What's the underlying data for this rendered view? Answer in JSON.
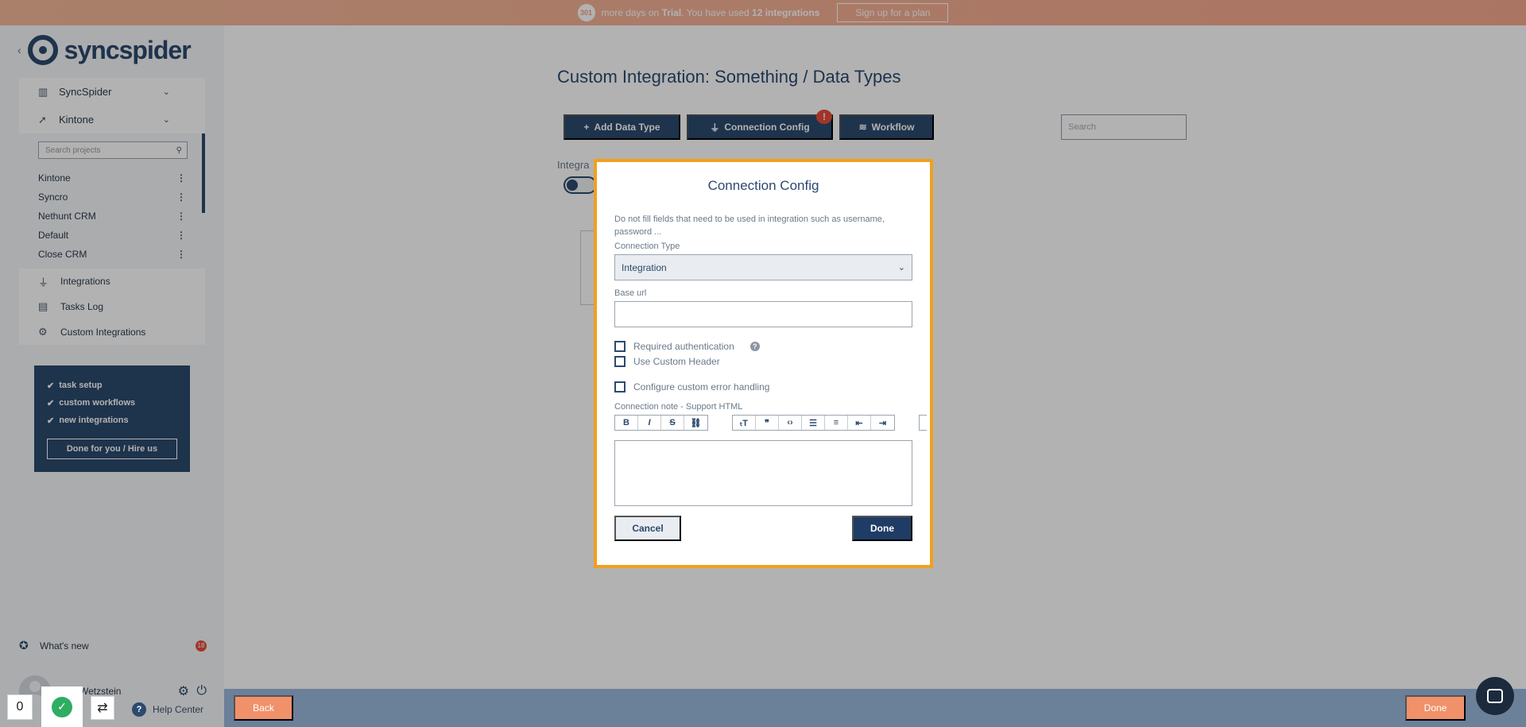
{
  "trial": {
    "days": "301",
    "text_pre": "more days on",
    "plan": "Trial",
    "text_mid": ". You have used",
    "count": "12 integrations",
    "signup_label": "Sign up for a plan"
  },
  "sidebar": {
    "brand": "syncspider",
    "orgs": [
      {
        "label": "SyncSpider",
        "icon": "building-icon"
      },
      {
        "label": "Kintone",
        "icon": "rocket-icon"
      }
    ],
    "project_search_placeholder": "Search projects",
    "projects": [
      "Kintone",
      "Syncro",
      "Nethunt CRM",
      "Default",
      "Close CRM"
    ],
    "nav": [
      {
        "label": "Integrations",
        "icon": "plug-icon"
      },
      {
        "label": "Tasks Log",
        "icon": "clipboard-icon"
      },
      {
        "label": "Custom Integrations",
        "icon": "gear-icon"
      }
    ],
    "promo": {
      "items": [
        "task setup",
        "custom workflows",
        "new integrations"
      ],
      "button": "Done for you / Hire us"
    },
    "whats_new": "What's new",
    "whats_new_count": "18",
    "user_name": "Igor Wetzstein",
    "help": "Help Center"
  },
  "main": {
    "title": "Custom Integration: Something / Data Types",
    "buttons": {
      "add": "Add Data Type",
      "connection": "Connection Config",
      "workflow": "Workflow"
    },
    "alert": "!",
    "search_placeholder": "Search",
    "integration_label": "Integra"
  },
  "modal": {
    "title": "Connection Config",
    "description": "Do not fill fields that need to be used in integration such as username, password ...",
    "connection_type_label": "Connection Type",
    "connection_type_value": "Integration",
    "base_url_label": "Base url",
    "base_url_value": "",
    "checkboxes": {
      "required_auth": "Required authentication",
      "custom_header": "Use Custom Header",
      "error_handling": "Configure custom error handling"
    },
    "note_label": "Connection note - Support HTML",
    "cancel": "Cancel",
    "done": "Done"
  },
  "bottom": {
    "back": "Back",
    "done": "Done"
  },
  "widgets": {
    "count": "0"
  },
  "colors": {
    "primary": "#2b4a6e",
    "accent": "#f0916a",
    "highlight": "#f0a020",
    "alert": "#e74c3c"
  }
}
